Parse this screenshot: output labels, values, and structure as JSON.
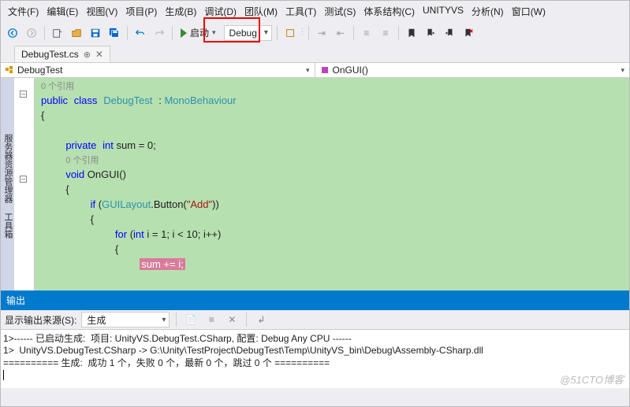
{
  "menu": [
    "文件(F)",
    "编辑(E)",
    "视图(V)",
    "项目(P)",
    "生成(B)",
    "调试(D)",
    "团队(M)",
    "工具(T)",
    "测试(S)",
    "体系结构(C)",
    "UNITYVS",
    "分析(N)",
    "窗口(W)"
  ],
  "toolbar": {
    "start_label": "启动",
    "config": "Debug"
  },
  "tab": {
    "filename": "DebugTest.cs"
  },
  "nav": {
    "class": "DebugTest",
    "method": "OnGUI()"
  },
  "code": {
    "ref0": "0 个引用",
    "l1a": "public",
    "l1b": "class",
    "l1c": "DebugTest",
    "l1d": ": ",
    "l1e": "MonoBehaviour",
    "l2": "{",
    "l3": "",
    "l4a": "private",
    "l4b": "int",
    "l4c": " sum = 0;",
    "ref1": "0 个引用",
    "l5a": "void",
    "l5b": " OnGUI()",
    "l6": "{",
    "l7a": "if",
    "l7b": " (",
    "l7c": "GUILayout",
    "l7d": ".Button(",
    "l7e": "\"Add\"",
    "l7f": "))",
    "l8": "{",
    "l9a": "for",
    "l9b": " (",
    "l9c": "int",
    "l9d": " i = 1; i < 10; i++)",
    "l10": "{",
    "l11": "sum += i;"
  },
  "output": {
    "title": "输出",
    "source_label": "显示输出来源(S):",
    "source_value": "生成",
    "lines": [
      "1>------ 已启动生成:  项目: UnityVS.DebugTest.CSharp, 配置: Debug Any CPU ------",
      "1>  UnityVS.DebugTest.CSharp -> G:\\Unity\\TestProject\\DebugTest\\Temp\\UnityVS_bin\\Debug\\Assembly-CSharp.dll",
      "========== 生成:  成功 1 个，失败 0 个，最新 0 个，跳过 0 个 =========="
    ]
  },
  "watermark": "@51CTO博客"
}
